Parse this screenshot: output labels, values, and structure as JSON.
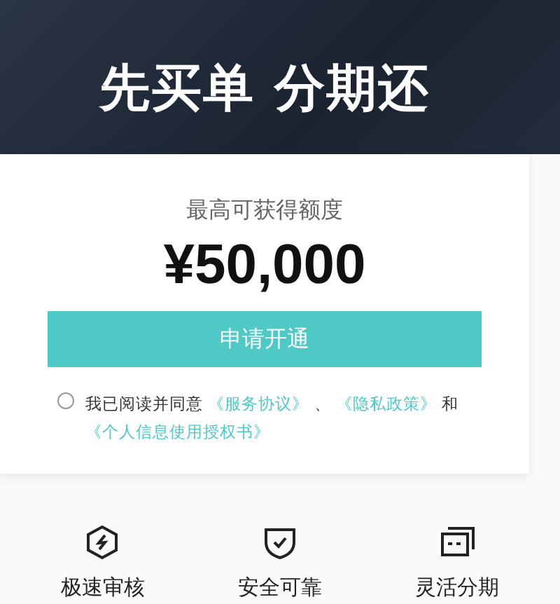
{
  "banner": {
    "headline": "先买单 分期还"
  },
  "card": {
    "label": "最高可获得额度",
    "amount": "¥50,000",
    "button": "申请开通",
    "agreement": {
      "checked": false,
      "parts": [
        {
          "kind": "text",
          "text": "我已阅读并同意"
        },
        {
          "kind": "link",
          "text": "《服务协议》"
        },
        {
          "kind": "text",
          "text": "、"
        },
        {
          "kind": "link",
          "text": "《隐私政策》"
        },
        {
          "kind": "text",
          "text": "和"
        },
        {
          "kind": "link",
          "text": "《个人信息使用授权书》"
        }
      ]
    }
  },
  "features": [
    {
      "kind": "speed",
      "title": "极速审核"
    },
    {
      "kind": "secure",
      "title": "安全可靠"
    },
    {
      "kind": "flexible",
      "title": "灵活分期"
    }
  ]
}
